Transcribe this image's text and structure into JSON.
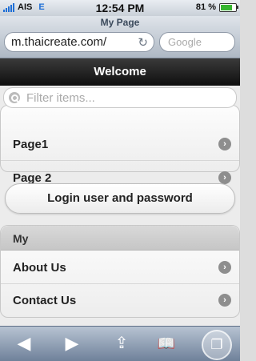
{
  "status_bar": {
    "carrier": "AIS",
    "network": "E",
    "time": "12:54 PM",
    "battery": "81 %"
  },
  "browser": {
    "page_title": "My Page",
    "url": "m.thaicreate.com/",
    "search_placeholder": "Google"
  },
  "header": {
    "title": "Welcome"
  },
  "filter": {
    "placeholder": "Filter items..."
  },
  "list1": {
    "items": [
      "Page1",
      "Page 2"
    ]
  },
  "login_button": "Login user and password",
  "list2": {
    "divider": "My",
    "items": [
      "About Us",
      "Contact Us"
    ]
  },
  "icons": {
    "reload": "reload-icon",
    "chevron": "chevron-right-icon",
    "back": "back-icon",
    "forward": "forward-icon",
    "share": "share-icon",
    "bookmarks": "bookmarks-icon",
    "pages": "pages-icon"
  }
}
